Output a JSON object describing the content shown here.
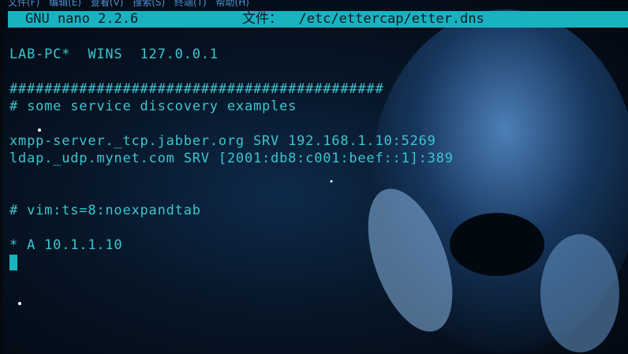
{
  "menubar": {
    "items": "文件(F)  编辑(E)  查看(V)  搜索(S)  终端(T)  帮助(H)"
  },
  "titlebar": {
    "app": "GNU nano 2.2.6",
    "file": "文件：  /etc/ettercap/etter.dns"
  },
  "editor": {
    "lines": [
      "",
      "LAB-PC*  WINS  127.0.0.1",
      "",
      "###########################################",
      "# some service discovery examples",
      "",
      "xmpp-server._tcp.jabber.org SRV 192.168.1.10:5269",
      "ldap._udp.mynet.com SRV [2001:db8:c001:beef::1]:389",
      "",
      "",
      "# vim:ts=8:noexpandtab",
      "",
      "* A 10.1.1.10"
    ]
  },
  "colors": {
    "title_bg": "#19b3c0",
    "text": "#3cc6cf"
  }
}
